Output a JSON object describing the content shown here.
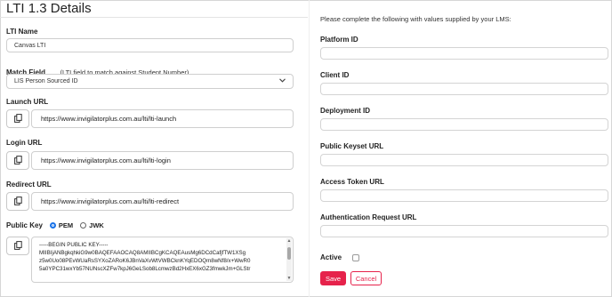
{
  "page": {
    "title": "LTI 1.3 Details"
  },
  "left": {
    "lti_name": {
      "label": "LTI Name",
      "value": "Canvas LTI"
    },
    "match_field": {
      "label": "Match Field",
      "hint": "(LTI field to match against Student Number)",
      "selected": "LIS Person Sourced ID"
    },
    "launch_url": {
      "label": "Launch URL",
      "value": "https://www.invigilatorplus.com.au/lti/lti-launch"
    },
    "login_url": {
      "label": "Login URL",
      "value": "https://www.invigilatorplus.com.au/lti/lti-login"
    },
    "redirect_url": {
      "label": "Redirect URL",
      "value": "https://www.invigilatorplus.com.au/lti/lti-redirect"
    },
    "public_key": {
      "label": "Public Key",
      "options": [
        {
          "label": "PEM",
          "selected": true
        },
        {
          "label": "JWK",
          "selected": false
        }
      ],
      "lines": [
        "-----BEGIN PUBLIC KEY-----",
        "MIIBIjANBgkqhkiG9w0BAQEFAAOCAQ8AMIIBCgKCAQEAusMg6DCdCafjfTW1XSg",
        "z5w0Uo08PEvWUaRsSYXoZARoK6JBnVaXvWtVWBCknKYqEDOQm8wNf8/x+WwR0",
        "5a0YPC31wxYb57NUNscXZFw7kpJ6GeLSob8LcmwzBd2HxEX6xGZ3fmwkJm+GLStr"
      ]
    },
    "icons": {
      "copy": "copy-icon",
      "dropdown": "chevron-down-icon"
    }
  },
  "right": {
    "instructions": "Please complete the following with values supplied by your LMS:",
    "fields": [
      {
        "label": "Platform ID",
        "value": ""
      },
      {
        "label": "Client ID",
        "value": ""
      },
      {
        "label": "Deployment ID",
        "value": ""
      },
      {
        "label": "Public Keyset URL",
        "value": ""
      },
      {
        "label": "Access Token URL",
        "value": ""
      },
      {
        "label": "Authentication Request URL",
        "value": ""
      }
    ],
    "active": {
      "label": "Active",
      "checked": false
    },
    "buttons": {
      "save": "Save",
      "cancel": "Cancel"
    }
  },
  "colors": {
    "accent": "#e6224b",
    "radio": "#1a73e8",
    "border": "#cfcfcf"
  }
}
